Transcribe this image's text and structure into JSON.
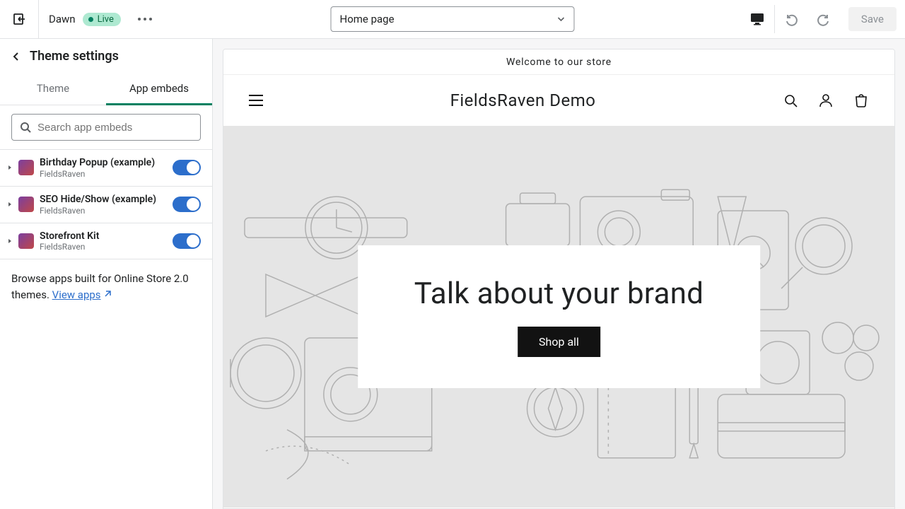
{
  "topbar": {
    "theme_name": "Dawn",
    "status_label": "Live",
    "page_select": "Home page",
    "save_label": "Save"
  },
  "sidebar": {
    "title": "Theme settings",
    "tabs": {
      "theme": "Theme",
      "embeds": "App embeds"
    },
    "search_placeholder": "Search app embeds",
    "embeds": [
      {
        "title": "Birthday Popup (example)",
        "subtitle": "FieldsRaven"
      },
      {
        "title": "SEO Hide/Show (example)",
        "subtitle": "FieldsRaven"
      },
      {
        "title": "Storefront Kit",
        "subtitle": "FieldsRaven"
      }
    ],
    "browse_text": "Browse apps built for Online Store 2.0 themes. ",
    "browse_link": "View apps"
  },
  "preview": {
    "announcement": "Welcome to our store",
    "store_name": "FieldsRaven Demo",
    "hero_heading": "Talk about your brand",
    "hero_button": "Shop all"
  }
}
